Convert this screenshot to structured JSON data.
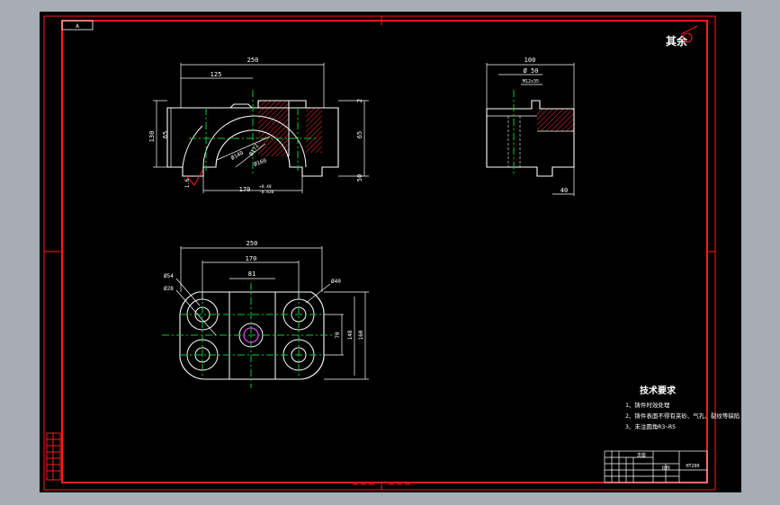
{
  "colors": {
    "background": "#000000",
    "chrome": "#a6adb5",
    "border": "#ff1a1a",
    "outline": "#ffffff",
    "center_line": "#00cc33",
    "hatch": "#ff3333",
    "accent": "#cc33cc"
  },
  "title_tag": "A",
  "top_right_note": "其余",
  "front_view": {
    "dim_overall_width": "250",
    "dim_half_width": "125",
    "dim_height": "130",
    "dim_inner_height": "65",
    "dim_right_top": "2",
    "dim_right_mid": "65",
    "dim_right_bottom": "50",
    "dim_bottom": "170",
    "dim_bottom_tol_upper": "+0.40",
    "dim_bottom_tol_lower": "-0.820",
    "dim_dia_140": "Ø140",
    "dim_dia_172": "Ø172",
    "dim_dia_160": "Ø160",
    "roughness_left": "1.6"
  },
  "side_view": {
    "dim_width": "100",
    "dim_dia": "Ø 50",
    "dim_mid": "M12x35",
    "dim_bottom": "40"
  },
  "top_view": {
    "dim_overall_width": "250",
    "dim_pitch": "170",
    "dim_center": "81",
    "dim_dia_54": "Ø54",
    "dim_dia_28": "Ø28",
    "dim_dia_40": "Ø40",
    "dim_height_70": "70",
    "dim_height_148": "148",
    "dim_height_160": "160"
  },
  "tech_requirements": {
    "heading": "技术要求",
    "items": [
      "1、铸件时效处理",
      "2、铸件表面不得有夹砂、气孔、裂纹等缺陷",
      "3、未注圆角R3~R5"
    ]
  },
  "title_block": {
    "part_name": "支座",
    "scale_label": "比例",
    "material": "HT200"
  }
}
